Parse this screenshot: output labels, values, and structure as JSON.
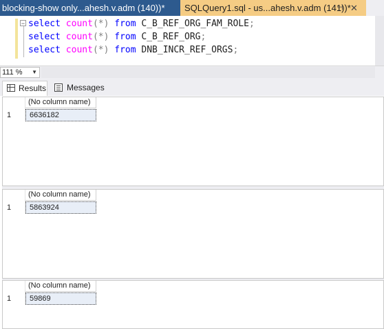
{
  "tabs": {
    "inactive": "blocking-show only...ahesh.v.adm (140))*",
    "active": "SQLQuery1.sql - us...ahesh.v.adm (141))*",
    "pin_glyph": "⊣",
    "close_glyph": "✕"
  },
  "editor": {
    "lines": [
      {
        "kw1": "select",
        "fn": "count",
        "args": "(*)",
        "kw2": "from",
        "table": "C_B_REF_ORG_FAM_ROLE",
        "end": ";"
      },
      {
        "kw1": "select",
        "fn": "count",
        "args": "(*)",
        "kw2": "from",
        "table": "C_B_REF_ORG",
        "end": ";"
      },
      {
        "kw1": "select",
        "fn": "count",
        "args": "(*)",
        "kw2": "from",
        "table": "DNB_INCR_REF_ORGS",
        "end": ";"
      }
    ],
    "fold_glyph": "−"
  },
  "zoom": {
    "value": "111 %",
    "arrow": "▼"
  },
  "result_tabs": {
    "results": "Results",
    "messages": "Messages"
  },
  "grids": [
    {
      "header": "(No column name)",
      "row": "1",
      "value": "6636182"
    },
    {
      "header": "(No column name)",
      "row": "1",
      "value": "5863924"
    },
    {
      "header": "(No column name)",
      "row": "1",
      "value": "59869"
    }
  ],
  "colors": {
    "active_tab": "#f5cc84",
    "inactive_tab": "#2d5a8e",
    "keyword": "#0000ff",
    "function": "#ff00ff"
  }
}
